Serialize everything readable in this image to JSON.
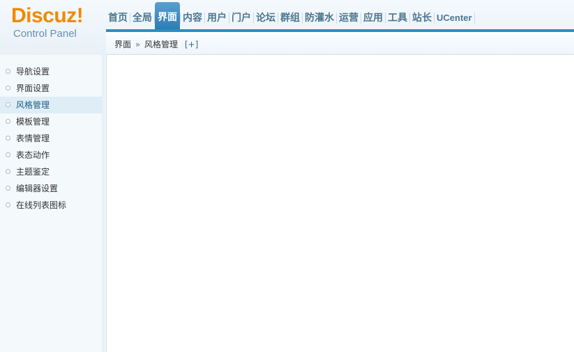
{
  "logo": {
    "brand": "Discuz!",
    "subtitle": "Control Panel"
  },
  "nav": {
    "items": [
      "首页",
      "全局",
      "界面",
      "内容",
      "用户",
      "门户",
      "论坛",
      "群组",
      "防灌水",
      "运营",
      "应用",
      "工具",
      "站长",
      "UCenter"
    ],
    "active_index": 2
  },
  "breadcrumb": {
    "section": "界面",
    "separator": "»",
    "page": "风格管理",
    "add": "[+]"
  },
  "sidebar": {
    "items": [
      "导航设置",
      "界面设置",
      "风格管理",
      "模板管理",
      "表情管理",
      "表态动作",
      "主题鉴定",
      "编辑器设置",
      "在线列表图标"
    ],
    "active_index": 2
  },
  "colors": {
    "brand": "#f08a00",
    "accent": "#2a8fbf",
    "nav_text": "#4c7691"
  }
}
